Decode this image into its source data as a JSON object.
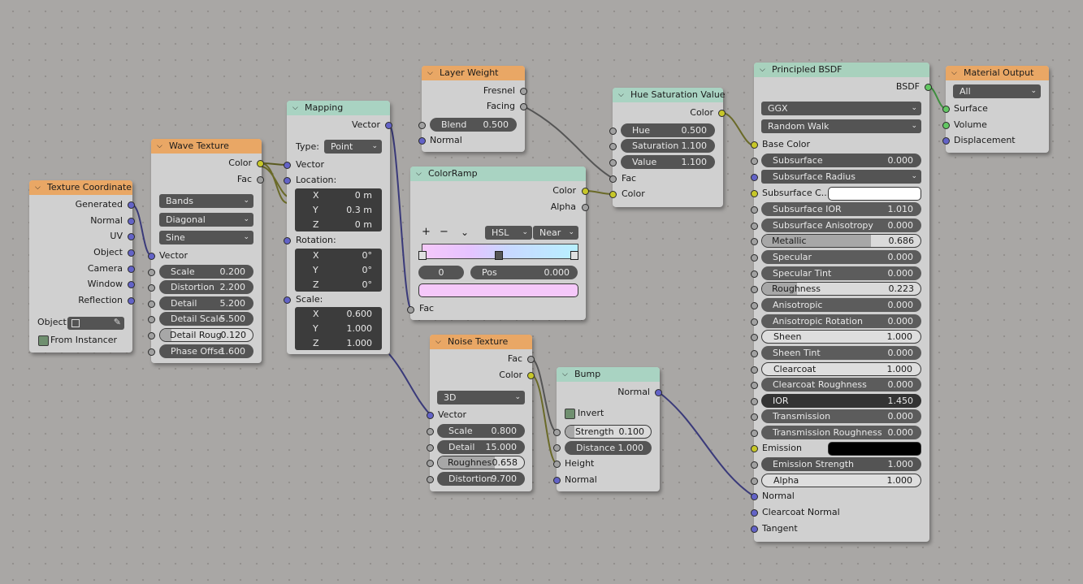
{
  "texture_coordinate": {
    "title": "Texture Coordinate",
    "outputs": [
      "Generated",
      "Normal",
      "UV",
      "Object",
      "Camera",
      "Window",
      "Reflection"
    ],
    "object_label": "Object:",
    "from_instancer": "From Instancer"
  },
  "wave_texture": {
    "title": "Wave Texture",
    "out_color": "Color",
    "out_fac": "Fac",
    "type": "Bands",
    "direction": "Diagonal",
    "profile": "Sine",
    "in_vector": "Vector",
    "fields": [
      {
        "label": "Scale",
        "value": "0.200"
      },
      {
        "label": "Distortion",
        "value": "2.200"
      },
      {
        "label": "Detail",
        "value": "5.200"
      },
      {
        "label": "Detail Scale",
        "value": "5.500"
      },
      {
        "label": "Detail Roug",
        "value": "0.120"
      },
      {
        "label": "Phase Offse",
        "value": "1.600"
      }
    ],
    "detail_roughness_fill": 0.12
  },
  "mapping": {
    "title": "Mapping",
    "out_vector": "Vector",
    "type_label": "Type:",
    "type_value": "Point",
    "in_vector": "Vector",
    "location_label": "Location:",
    "location": [
      {
        "axis": "X",
        "value": "0 m"
      },
      {
        "axis": "Y",
        "value": "0.3 m"
      },
      {
        "axis": "Z",
        "value": "0 m"
      }
    ],
    "rotation_label": "Rotation:",
    "rotation": [
      {
        "axis": "X",
        "value": "0°"
      },
      {
        "axis": "Y",
        "value": "0°"
      },
      {
        "axis": "Z",
        "value": "0°"
      }
    ],
    "scale_label": "Scale:",
    "scale": [
      {
        "axis": "X",
        "value": "0.600"
      },
      {
        "axis": "Y",
        "value": "1.000"
      },
      {
        "axis": "Z",
        "value": "1.000"
      }
    ]
  },
  "layer_weight": {
    "title": "Layer Weight",
    "out_fresnel": "Fresnel",
    "out_facing": "Facing",
    "blend_label": "Blend",
    "blend_value": "0.500",
    "in_normal": "Normal"
  },
  "color_ramp": {
    "title": "ColorRamp",
    "out_color": "Color",
    "out_alpha": "Alpha",
    "btn_add": "+",
    "btn_remove": "−",
    "btn_more": "⌄",
    "mode": "HSL",
    "interp": "Near",
    "index": "0",
    "pos_label": "Pos",
    "pos_value": "0.000",
    "in_fac": "Fac"
  },
  "hue_sat": {
    "title": "Hue Saturation Value",
    "out_color": "Color",
    "fields": [
      {
        "label": "Hue",
        "value": "0.500"
      },
      {
        "label": "Saturation",
        "value": "1.100"
      },
      {
        "label": "Value",
        "value": "1.100"
      }
    ],
    "in_fac": "Fac",
    "in_color": "Color"
  },
  "noise_texture": {
    "title": "Noise Texture",
    "out_fac": "Fac",
    "out_color": "Color",
    "dimensions": "3D",
    "in_vector": "Vector",
    "fields": [
      {
        "label": "Scale",
        "value": "0.800"
      },
      {
        "label": "Detail",
        "value": "15.000"
      },
      {
        "label": "Roughnes",
        "value": "0.658"
      },
      {
        "label": "Distortion",
        "value": "9.700"
      }
    ],
    "roughness_fill": 0.658
  },
  "bump": {
    "title": "Bump",
    "out_normal": "Normal",
    "invert": "Invert",
    "strength_label": "Strength",
    "strength_value": "0.100",
    "strength_fill": 0.1,
    "distance_label": "Distance",
    "distance_value": "1.000",
    "in_height": "Height",
    "in_normal": "Normal"
  },
  "principled": {
    "title": "Principled BSDF",
    "out_bsdf": "BSDF",
    "distribution": "GGX",
    "subsurface_method": "Random Walk",
    "base_color": "Base Color",
    "subsurface": {
      "label": "Subsurface",
      "value": "0.000"
    },
    "subsurface_radius": "Subsurface Radius",
    "subsurface_color": "Subsurface C...",
    "rows": [
      {
        "label": "Subsurface IOR",
        "value": "1.010",
        "style": "dark"
      },
      {
        "label": "Subsurface Anisotropy",
        "value": "0.000",
        "style": "dark"
      },
      {
        "label": "Metallic",
        "value": "0.686",
        "style": "slider",
        "fill": 0.686
      },
      {
        "label": "Specular",
        "value": "0.000",
        "style": "dark"
      },
      {
        "label": "Specular Tint",
        "value": "0.000",
        "style": "dark"
      },
      {
        "label": "Roughness",
        "value": "0.223",
        "style": "slider",
        "fill": 0.223
      },
      {
        "label": "Anisotropic",
        "value": "0.000",
        "style": "dark"
      },
      {
        "label": "Anisotropic Rotation",
        "value": "0.000",
        "style": "dark"
      },
      {
        "label": "Sheen",
        "value": "1.000",
        "style": "light"
      },
      {
        "label": "Sheen Tint",
        "value": "0.000",
        "style": "dark"
      },
      {
        "label": "Clearcoat",
        "value": "1.000",
        "style": "light"
      },
      {
        "label": "Clearcoat Roughness",
        "value": "0.000",
        "style": "dark"
      },
      {
        "label": "IOR",
        "value": "1.450",
        "style": "darkest"
      },
      {
        "label": "Transmission",
        "value": "0.000",
        "style": "dark"
      },
      {
        "label": "Transmission Roughness",
        "value": "0.000",
        "style": "dark"
      }
    ],
    "emission": "Emission",
    "emission_strength": {
      "label": "Emission Strength",
      "value": "1.000"
    },
    "alpha": {
      "label": "Alpha",
      "value": "1.000"
    },
    "in_normal": "Normal",
    "in_clearcoat_normal": "Clearcoat Normal",
    "in_tangent": "Tangent"
  },
  "material_output": {
    "title": "Material Output",
    "target": "All",
    "in_surface": "Surface",
    "in_volume": "Volume",
    "in_displacement": "Displacement"
  },
  "colors": {
    "socket_color": "#c7c729",
    "socket_float": "#a1a1a1",
    "socket_vector": "#6363c7",
    "socket_shader": "#63c763",
    "wire": "#3b3b3b"
  }
}
